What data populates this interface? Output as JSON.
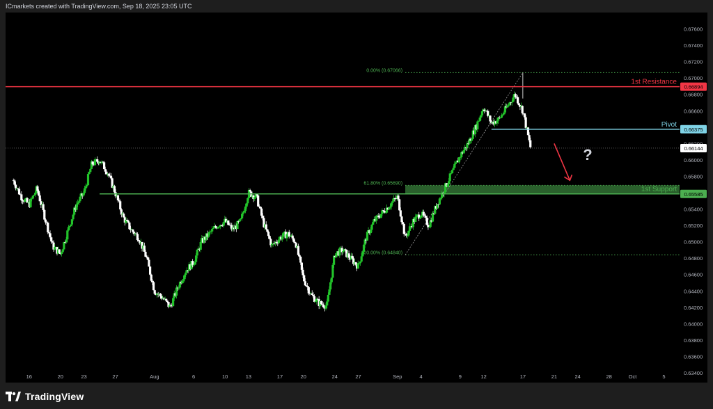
{
  "attribution": "ICmarkets created with TradingView.com, Sep 18, 2025 23:05 UTC",
  "brand": "TradingView",
  "colors": {
    "background": "#000000",
    "frame": "#1e1e1e",
    "bull": "#22c22a",
    "bear": "#ffffff",
    "resistance": "#f23645",
    "pivot": "#7fd3e6",
    "support": "#4caf50",
    "fib": "#4caf50",
    "arrow": "#f23645",
    "question": "#d1d4dc"
  },
  "chart_data": {
    "type": "candlestick",
    "symbol_context": "price chart with horizontal levels and fibonacci retracement",
    "ylim": [
      0.634,
      0.678
    ],
    "y_ticks": [
      "0.67600",
      "0.67400",
      "0.67200",
      "0.67000",
      "0.66800",
      "0.66600",
      "0.66400",
      "0.66200",
      "0.66000",
      "0.65800",
      "0.65600",
      "0.65400",
      "0.65200",
      "0.65000",
      "0.64800",
      "0.64600",
      "0.64400",
      "0.64200",
      "0.64000",
      "0.63800",
      "0.63600",
      "0.63400"
    ],
    "y_tick_values": [
      0.676,
      0.674,
      0.672,
      0.67,
      0.668,
      0.666,
      0.664,
      0.662,
      0.66,
      0.658,
      0.656,
      0.654,
      0.652,
      0.65,
      0.648,
      0.646,
      0.644,
      0.642,
      0.64,
      0.638,
      0.636,
      0.634
    ],
    "x_ticks": [
      "16",
      "20",
      "23",
      "27",
      "Aug",
      "6",
      "10",
      "13",
      "17",
      "20",
      "24",
      "27",
      "Sep",
      "4",
      "9",
      "12",
      "17",
      "21",
      "24",
      "28",
      "Oct",
      "5"
    ],
    "x_tick_dates": [
      "2025-07-16",
      "2025-07-20",
      "2025-07-23",
      "2025-07-27",
      "2025-08-01",
      "2025-08-06",
      "2025-08-10",
      "2025-08-13",
      "2025-08-17",
      "2025-08-20",
      "2025-08-24",
      "2025-08-27",
      "2025-09-01",
      "2025-09-04",
      "2025-09-09",
      "2025-09-12",
      "2025-09-17",
      "2025-09-21",
      "2025-09-24",
      "2025-09-28",
      "2025-10-01",
      "2025-10-05"
    ],
    "x_range": [
      "2025-07-13",
      "2025-10-07"
    ],
    "price_path": [
      [
        "2025-07-14",
        0.6575
      ],
      [
        "2025-07-15",
        0.6555
      ],
      [
        "2025-07-16",
        0.6545
      ],
      [
        "2025-07-17",
        0.6565
      ],
      [
        "2025-07-18",
        0.653
      ],
      [
        "2025-07-19",
        0.6495
      ],
      [
        "2025-07-20",
        0.6485
      ],
      [
        "2025-07-21",
        0.6515
      ],
      [
        "2025-07-22",
        0.6545
      ],
      [
        "2025-07-23",
        0.656
      ],
      [
        "2025-07-24",
        0.6595
      ],
      [
        "2025-07-25",
        0.66
      ],
      [
        "2025-07-26",
        0.6585
      ],
      [
        "2025-07-27",
        0.656
      ],
      [
        "2025-07-28",
        0.653
      ],
      [
        "2025-07-29",
        0.6515
      ],
      [
        "2025-07-30",
        0.6505
      ],
      [
        "2025-07-31",
        0.648
      ],
      [
        "2025-08-01",
        0.644
      ],
      [
        "2025-08-02",
        0.6432
      ],
      [
        "2025-08-03",
        0.642
      ],
      [
        "2025-08-04",
        0.6445
      ],
      [
        "2025-08-05",
        0.6465
      ],
      [
        "2025-08-06",
        0.6475
      ],
      [
        "2025-08-07",
        0.65
      ],
      [
        "2025-08-08",
        0.651
      ],
      [
        "2025-08-09",
        0.652
      ],
      [
        "2025-08-10",
        0.6525
      ],
      [
        "2025-08-11",
        0.6515
      ],
      [
        "2025-08-12",
        0.6525
      ],
      [
        "2025-08-13",
        0.656
      ],
      [
        "2025-08-14",
        0.6555
      ],
      [
        "2025-08-15",
        0.652
      ],
      [
        "2025-08-16",
        0.6495
      ],
      [
        "2025-08-17",
        0.6505
      ],
      [
        "2025-08-18",
        0.651
      ],
      [
        "2025-08-19",
        0.65
      ],
      [
        "2025-08-20",
        0.6455
      ],
      [
        "2025-08-21",
        0.6435
      ],
      [
        "2025-08-22",
        0.6425
      ],
      [
        "2025-08-23",
        0.6422
      ],
      [
        "2025-08-24",
        0.6485
      ],
      [
        "2025-08-25",
        0.649
      ],
      [
        "2025-08-26",
        0.648
      ],
      [
        "2025-08-27",
        0.647
      ],
      [
        "2025-08-28",
        0.6505
      ],
      [
        "2025-08-29",
        0.6525
      ],
      [
        "2025-08-30",
        0.6535
      ],
      [
        "2025-08-31",
        0.6545
      ],
      [
        "2025-09-01",
        0.6555
      ],
      [
        "2025-09-02",
        0.6505
      ],
      [
        "2025-09-03",
        0.6525
      ],
      [
        "2025-09-04",
        0.6535
      ],
      [
        "2025-09-05",
        0.652
      ],
      [
        "2025-09-06",
        0.6545
      ],
      [
        "2025-09-07",
        0.6565
      ],
      [
        "2025-09-08",
        0.6585
      ],
      [
        "2025-09-09",
        0.6605
      ],
      [
        "2025-09-10",
        0.662
      ],
      [
        "2025-09-11",
        0.664
      ],
      [
        "2025-09-12",
        0.6665
      ],
      [
        "2025-09-13",
        0.6645
      ],
      [
        "2025-09-14",
        0.665
      ],
      [
        "2025-09-15",
        0.6665
      ],
      [
        "2025-09-16",
        0.668
      ],
      [
        "2025-09-17",
        0.666
      ],
      [
        "2025-09-18",
        0.6614
      ]
    ],
    "levels": [
      {
        "name": "1st Resistance",
        "value": 0.66894,
        "label": "0.66894"
      },
      {
        "name": "Pivot",
        "value": 0.66375,
        "label": "0.66375"
      },
      {
        "name": "1st Support",
        "value": 0.65585,
        "label": "0.65585"
      }
    ],
    "fib": {
      "levels": [
        {
          "label": "0.00% (0.67066)",
          "value": 0.67066
        },
        {
          "label": "61.80% (0.65690)",
          "value": 0.6569
        },
        {
          "label": "100.00% (0.64840)",
          "value": 0.6484
        }
      ],
      "start_date": "2025-09-02",
      "end_date": "2025-09-17"
    },
    "current_price": {
      "value": 0.66144,
      "label": "0.66144"
    },
    "annotation": {
      "text": "?"
    }
  }
}
